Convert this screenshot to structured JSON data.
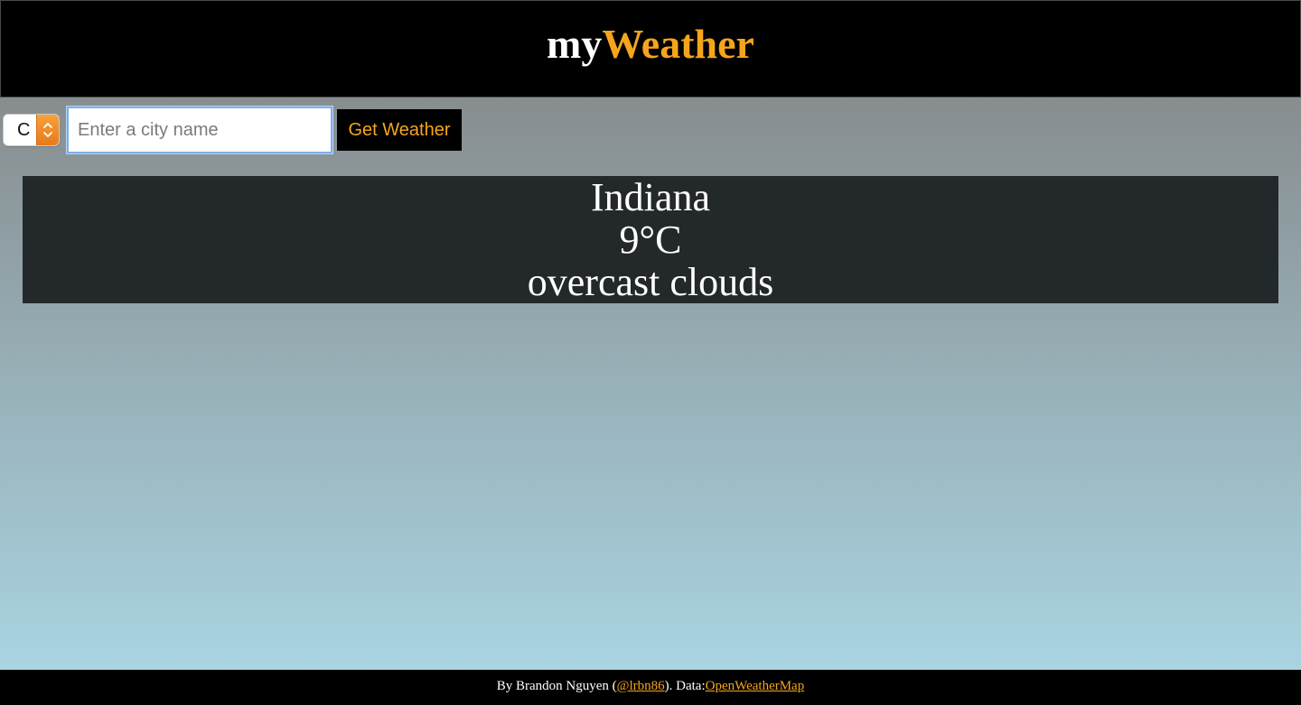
{
  "header": {
    "brand_prefix": "my",
    "brand_suffix": "Weather"
  },
  "controls": {
    "unit_selected": "C",
    "city_placeholder": "Enter a city name",
    "city_value": "",
    "submit_label": "Get Weather"
  },
  "weather": {
    "location": "Indiana",
    "temperature": "9°C",
    "description": "overcast clouds"
  },
  "footer": {
    "prefix": "By Brandon Nguyen (",
    "handle": "@lrbn86",
    "middle": "). Data: ",
    "source": "OpenWeatherMap"
  },
  "colors": {
    "accent": "#f5a51d",
    "header_bg": "#000000",
    "card_bg": "#23282a",
    "stepper": "#ee8a25",
    "input_focus": "#7eaee8"
  },
  "icons": {
    "unit_stepper": "up-down-chevron-icon"
  }
}
